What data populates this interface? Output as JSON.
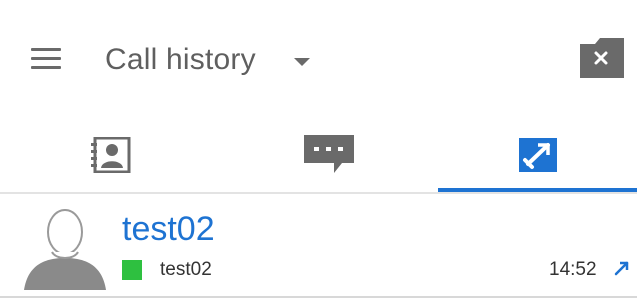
{
  "header": {
    "title": "Call history",
    "menu_icon": "hamburger-menu-icon",
    "dropdown_icon": "chevron-down-icon",
    "clear_icon": "clear-history-icon"
  },
  "tabs": [
    {
      "id": "contacts",
      "icon": "contacts-icon",
      "active": false
    },
    {
      "id": "chat",
      "icon": "chat-icon",
      "active": false
    },
    {
      "id": "call-history",
      "icon": "call-history-icon",
      "active": true
    }
  ],
  "calls": [
    {
      "name": "test02",
      "subtitle": "test02",
      "time": "14:52",
      "presence": "online",
      "direction": "outgoing",
      "direction_icon": "outgoing-call-arrow-icon"
    }
  ],
  "colors": {
    "accent": "#1e73d2",
    "presence_online": "#2ec040",
    "icon_gray": "#6a6a6a"
  }
}
